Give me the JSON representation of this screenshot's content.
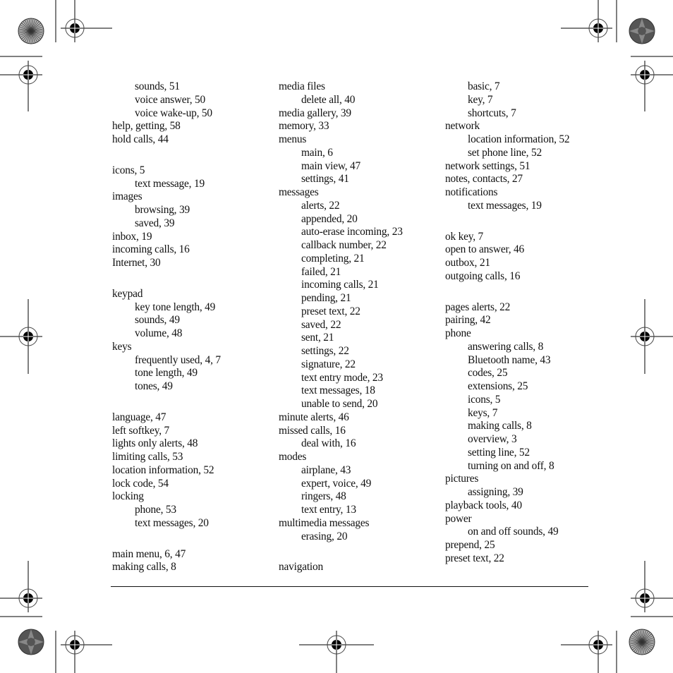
{
  "index": {
    "columns": [
      {
        "entries": [
          {
            "text": "sounds, 51",
            "level": 1
          },
          {
            "text": "voice answer, 50",
            "level": 1
          },
          {
            "text": "voice wake-up, 50",
            "level": 1
          },
          {
            "text": "help, getting, 58",
            "level": 0
          },
          {
            "text": "hold calls, 44",
            "level": 0
          },
          {
            "gap": true
          },
          {
            "text": "icons, 5",
            "level": 0
          },
          {
            "text": "text message, 19",
            "level": 1
          },
          {
            "text": "images",
            "level": 0
          },
          {
            "text": "browsing, 39",
            "level": 1
          },
          {
            "text": "saved, 39",
            "level": 1
          },
          {
            "text": "inbox, 19",
            "level": 0
          },
          {
            "text": "incoming calls, 16",
            "level": 0
          },
          {
            "text": "Internet, 30",
            "level": 0
          },
          {
            "gap": true
          },
          {
            "text": "keypad",
            "level": 0
          },
          {
            "text": "key tone length, 49",
            "level": 1
          },
          {
            "text": "sounds, 49",
            "level": 1
          },
          {
            "text": "volume, 48",
            "level": 1
          },
          {
            "text": "keys",
            "level": 0
          },
          {
            "text": "frequently used, 4, 7",
            "level": 1
          },
          {
            "text": "tone length, 49",
            "level": 1
          },
          {
            "text": "tones, 49",
            "level": 1
          },
          {
            "gap": true
          },
          {
            "text": "language, 47",
            "level": 0
          },
          {
            "text": "left softkey, 7",
            "level": 0
          },
          {
            "text": "lights only alerts, 48",
            "level": 0
          },
          {
            "text": "limiting calls, 53",
            "level": 0
          },
          {
            "text": "location information, 52",
            "level": 0
          },
          {
            "text": "lock code, 54",
            "level": 0
          },
          {
            "text": "locking",
            "level": 0
          },
          {
            "text": "phone, 53",
            "level": 1
          },
          {
            "text": "text messages, 20",
            "level": 1
          },
          {
            "gap": true
          },
          {
            "text": "main menu, 6, 47",
            "level": 0
          },
          {
            "text": "making calls, 8",
            "level": 0
          }
        ]
      },
      {
        "entries": [
          {
            "text": "media files",
            "level": 0
          },
          {
            "text": "delete all, 40",
            "level": 1
          },
          {
            "text": "media gallery, 39",
            "level": 0
          },
          {
            "text": "memory, 33",
            "level": 0
          },
          {
            "text": "menus",
            "level": 0
          },
          {
            "text": "main, 6",
            "level": 1
          },
          {
            "text": "main view, 47",
            "level": 1
          },
          {
            "text": "settings, 41",
            "level": 1
          },
          {
            "text": "messages",
            "level": 0
          },
          {
            "text": "alerts, 22",
            "level": 1
          },
          {
            "text": "appended, 20",
            "level": 1
          },
          {
            "text": "auto-erase incoming, 23",
            "level": 1
          },
          {
            "text": "callback number, 22",
            "level": 1
          },
          {
            "text": "completing, 21",
            "level": 1
          },
          {
            "text": "failed, 21",
            "level": 1
          },
          {
            "text": "incoming calls, 21",
            "level": 1
          },
          {
            "text": "pending, 21",
            "level": 1
          },
          {
            "text": "preset text, 22",
            "level": 1
          },
          {
            "text": "saved, 22",
            "level": 1
          },
          {
            "text": "sent, 21",
            "level": 1
          },
          {
            "text": "settings, 22",
            "level": 1
          },
          {
            "text": "signature, 22",
            "level": 1
          },
          {
            "text": "text entry mode, 23",
            "level": 1
          },
          {
            "text": "text messages, 18",
            "level": 1
          },
          {
            "text": "unable to send, 20",
            "level": 1
          },
          {
            "text": "minute alerts, 46",
            "level": 0
          },
          {
            "text": "missed calls, 16",
            "level": 0
          },
          {
            "text": "deal with, 16",
            "level": 1
          },
          {
            "text": "modes",
            "level": 0
          },
          {
            "text": "airplane, 43",
            "level": 1
          },
          {
            "text": "expert, voice, 49",
            "level": 1
          },
          {
            "text": "ringers, 48",
            "level": 1
          },
          {
            "text": "text entry, 13",
            "level": 1
          },
          {
            "text": "multimedia messages",
            "level": 0
          },
          {
            "text": "erasing, 20",
            "level": 1
          },
          {
            "gap": true
          },
          {
            "text": "navigation",
            "level": 0
          }
        ]
      },
      {
        "entries": [
          {
            "text": "basic, 7",
            "level": 1
          },
          {
            "text": "key, 7",
            "level": 1
          },
          {
            "text": "shortcuts, 7",
            "level": 1
          },
          {
            "text": "network",
            "level": 0
          },
          {
            "text": "location information, 52",
            "level": 1
          },
          {
            "text": "set phone line, 52",
            "level": 1
          },
          {
            "text": "network settings, 51",
            "level": 0
          },
          {
            "text": "notes, contacts, 27",
            "level": 0
          },
          {
            "text": "notifications",
            "level": 0
          },
          {
            "text": "text messages, 19",
            "level": 1
          },
          {
            "gap": true
          },
          {
            "text": "ok key, 7",
            "level": 0
          },
          {
            "text": "open to answer, 46",
            "level": 0
          },
          {
            "text": "outbox, 21",
            "level": 0
          },
          {
            "text": "outgoing calls, 16",
            "level": 0
          },
          {
            "gap": true
          },
          {
            "text": "pages alerts, 22",
            "level": 0
          },
          {
            "text": "pairing, 42",
            "level": 0
          },
          {
            "text": "phone",
            "level": 0
          },
          {
            "text": "answering calls, 8",
            "level": 1
          },
          {
            "text": "Bluetooth name, 43",
            "level": 1
          },
          {
            "text": "codes, 25",
            "level": 1
          },
          {
            "text": "extensions, 25",
            "level": 1
          },
          {
            "text": "icons, 5",
            "level": 1
          },
          {
            "text": "keys, 7",
            "level": 1
          },
          {
            "text": "making calls, 8",
            "level": 1
          },
          {
            "text": "overview, 3",
            "level": 1
          },
          {
            "text": "setting line, 52",
            "level": 1
          },
          {
            "text": "turning on and off, 8",
            "level": 1
          },
          {
            "text": "pictures",
            "level": 0
          },
          {
            "text": "assigning, 39",
            "level": 1
          },
          {
            "text": "playback tools, 40",
            "level": 0
          },
          {
            "text": "power",
            "level": 0
          },
          {
            "text": "on and off sounds, 49",
            "level": 1
          },
          {
            "text": "prepend, 25",
            "level": 0
          },
          {
            "text": "preset text, 22",
            "level": 0
          }
        ]
      }
    ]
  },
  "print_marks": {
    "registration_targets": [
      "top-left",
      "top-left-side",
      "left-middle",
      "bottom-left-side",
      "bottom-left",
      "bottom-center",
      "bottom-right",
      "bottom-right-side",
      "right-middle",
      "top-right-side",
      "top-right"
    ],
    "color_wheels": [
      "top-left",
      "top-right",
      "bottom-left",
      "bottom-right"
    ]
  }
}
